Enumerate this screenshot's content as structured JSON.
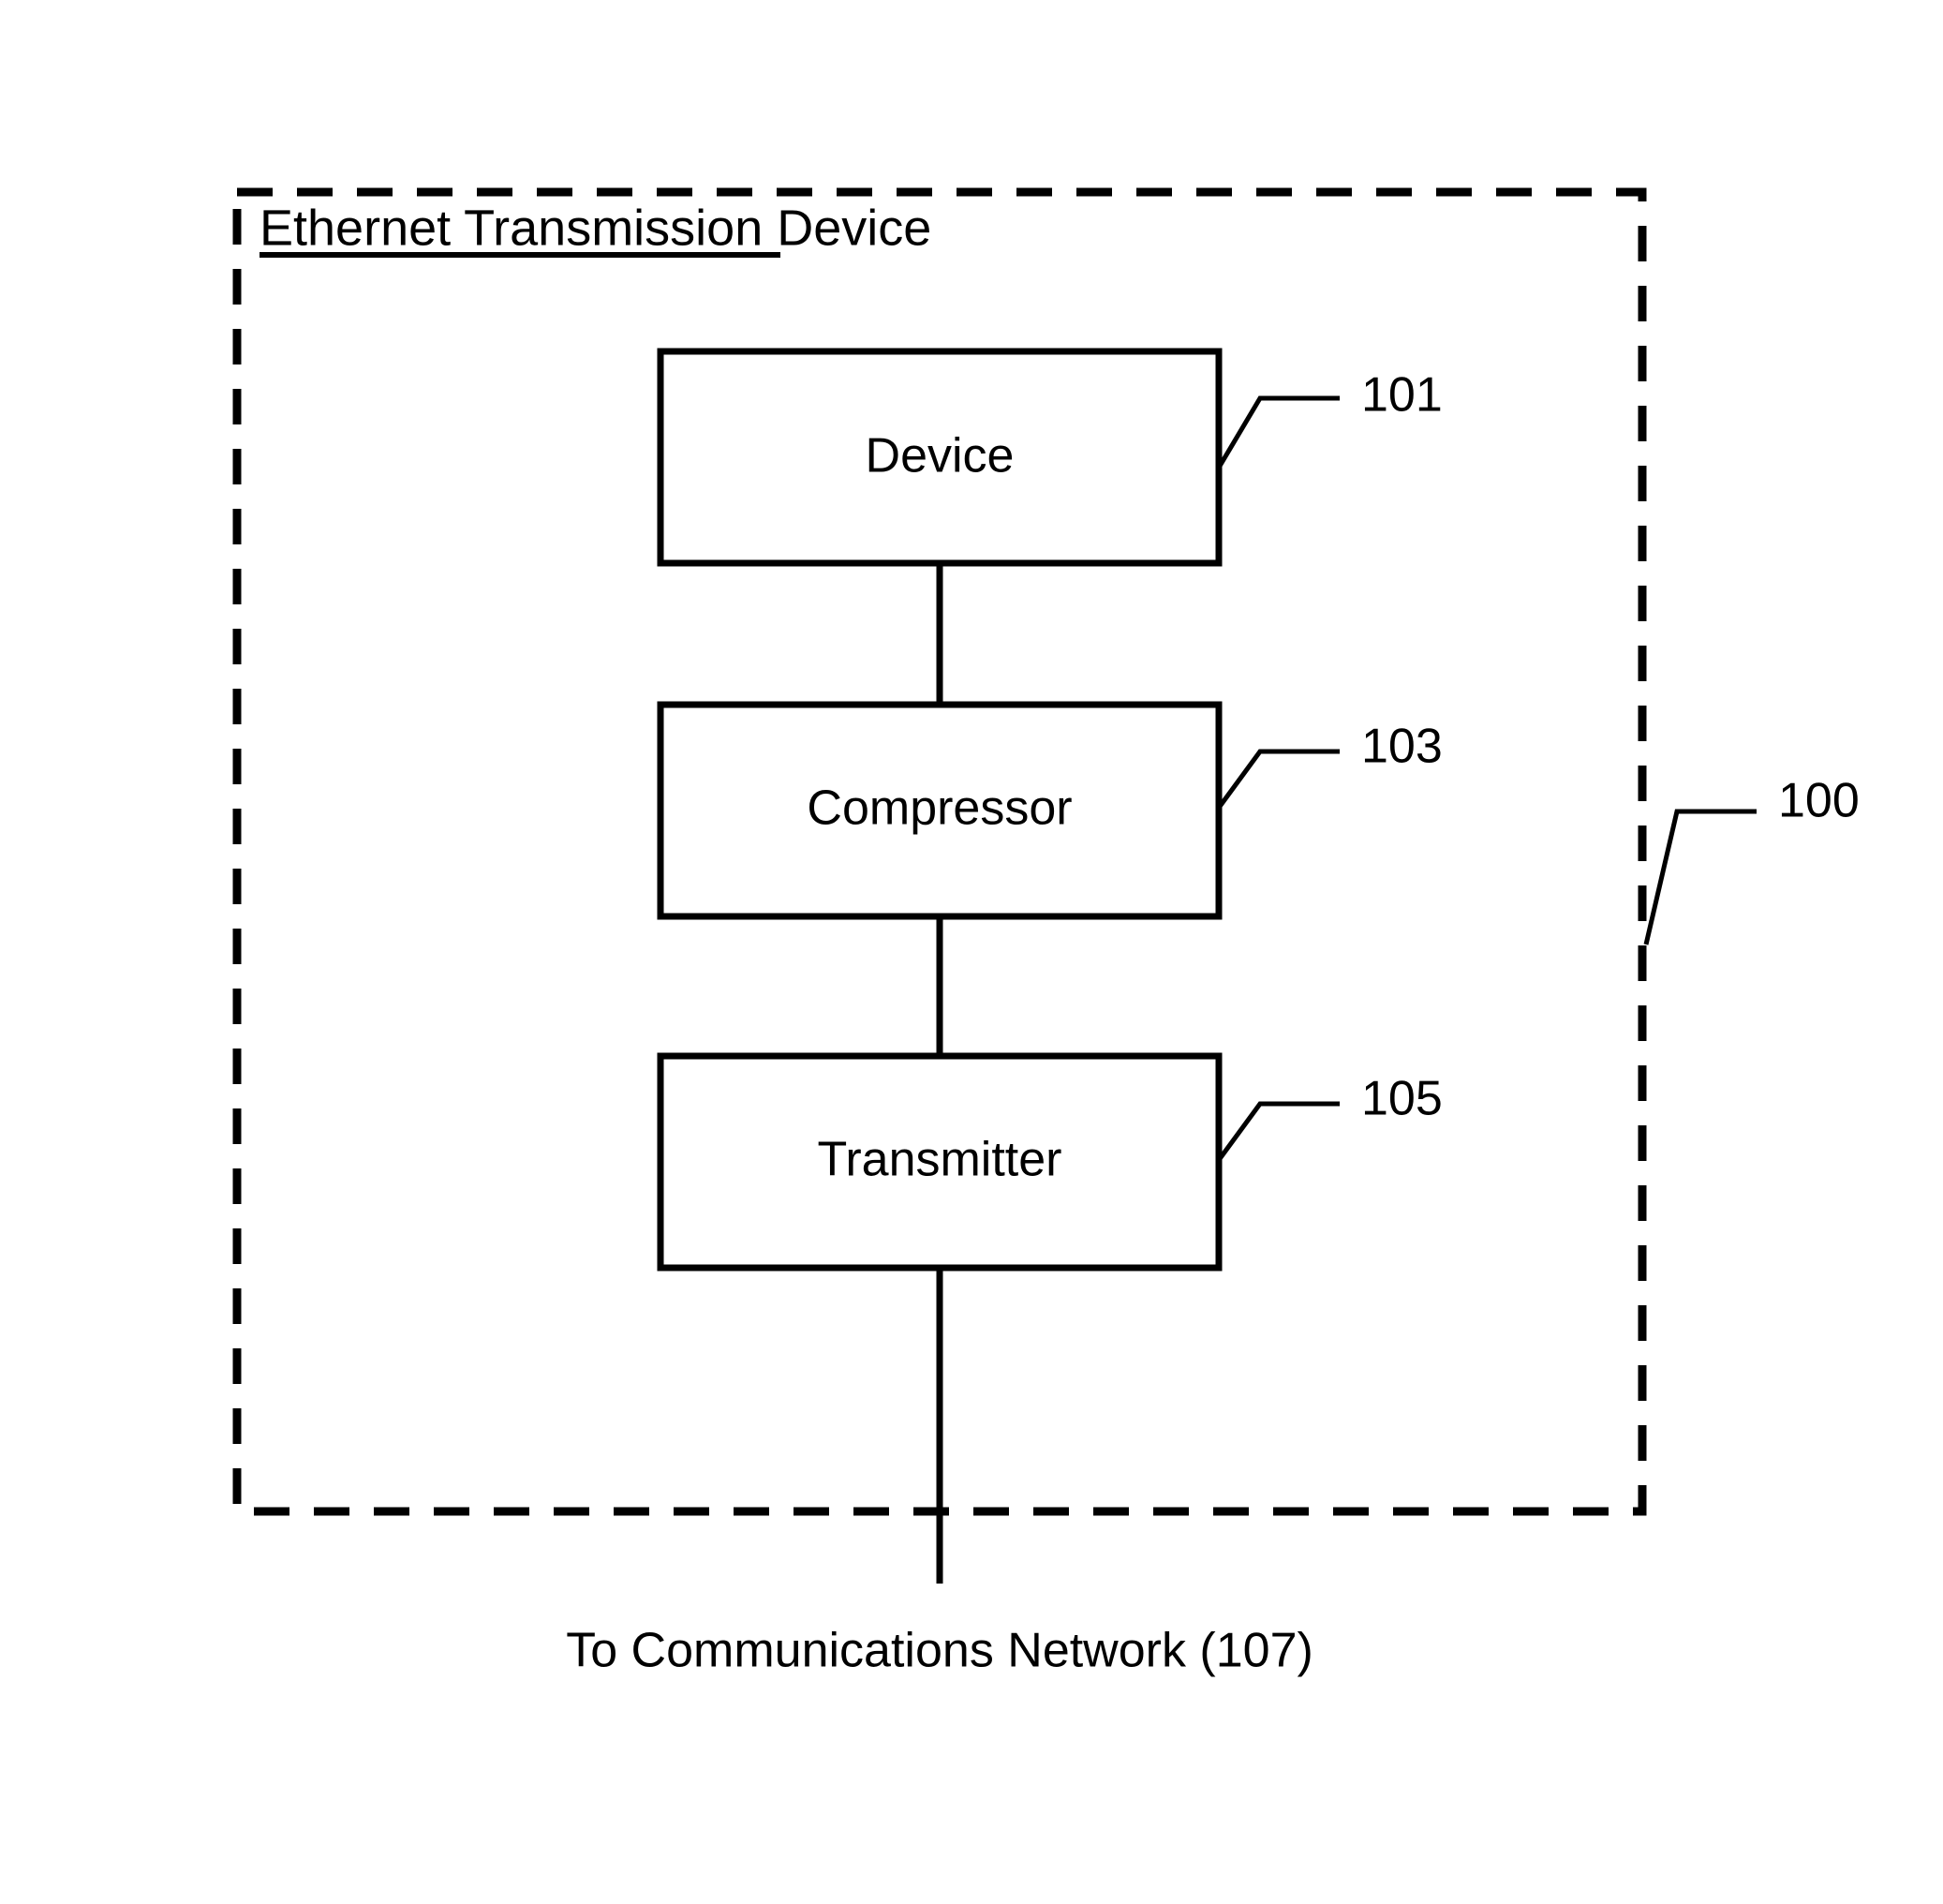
{
  "figure": {
    "enclosure": {
      "title": "Ethernet Transmission Device",
      "reference_numeral": "100",
      "border_style": "dashed",
      "color": "#000000"
    },
    "blocks": [
      {
        "id": "device",
        "label": "Device",
        "reference_numeral": "101"
      },
      {
        "id": "compressor",
        "label": "Compressor",
        "reference_numeral": "103"
      },
      {
        "id": "transmitter",
        "label": "Transmitter",
        "reference_numeral": "105"
      }
    ],
    "caption": {
      "text": "To Communications Network (107)",
      "reference_numeral": "107"
    },
    "colors": {
      "line": "#000000",
      "fill": "#ffffff",
      "text": "#000000"
    }
  }
}
